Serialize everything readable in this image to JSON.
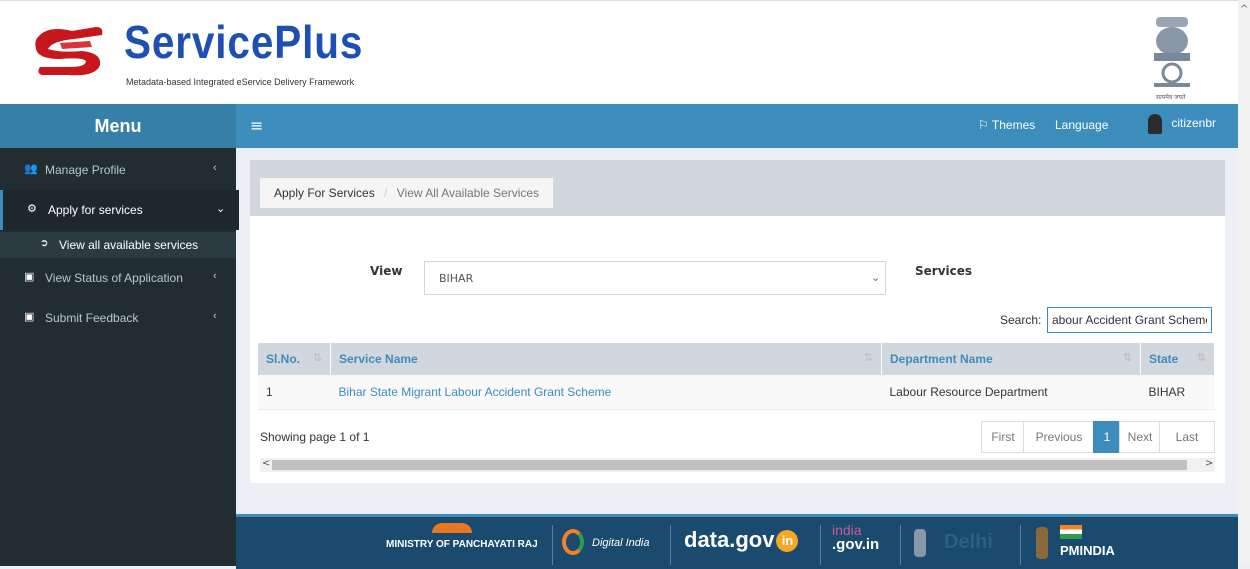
{
  "brand": {
    "title": "ServicePlus",
    "subtitle": "Metadata-based Integrated eService Delivery Framework",
    "emblem_caption": "सत्यमेव जयते"
  },
  "nav": {
    "menu_label": "Menu",
    "themes_label": "Themes",
    "language_label": "Language",
    "user_label": "citizenbr"
  },
  "sidebar": {
    "items": [
      {
        "label": "Manage Profile"
      },
      {
        "label": "Apply for services"
      },
      {
        "label": "View all available services"
      },
      {
        "label": "View Status of Application"
      },
      {
        "label": "Submit Feedback"
      }
    ]
  },
  "breadcrumb": {
    "first": "Apply For Services",
    "current": "View All Available Services"
  },
  "filters": {
    "view_label": "View",
    "view_value": "BIHAR",
    "services_label": "Services",
    "search_label": "Search:",
    "search_value": "abour Accident Grant Scheme"
  },
  "table": {
    "headers": [
      "Sl.No.",
      "Service Name",
      "Department Name",
      "State"
    ],
    "rows": [
      [
        "1",
        "Bihar State Migrant Labour Accident Grant Scheme",
        "Labour Resource Department",
        "BIHAR"
      ]
    ]
  },
  "pagination": {
    "showing": "Showing page 1 of 1",
    "first": "First",
    "previous": "Previous",
    "current": "1",
    "next": "Next",
    "last": "Last"
  },
  "footer": {
    "panchayati": "MINISTRY OF PANCHAYATI RAJ",
    "digital_india": "Digital India",
    "datagov": "data.gov",
    "datagov_in": "in",
    "indiagov": "india",
    "indiagov_sub": ".gov.in",
    "delhi": "Delhi",
    "pmindia": "PMINDIA"
  },
  "colors": {
    "primary": "#3c8dbc",
    "sidebar": "#222d32",
    "footer": "#1a4a6e"
  }
}
